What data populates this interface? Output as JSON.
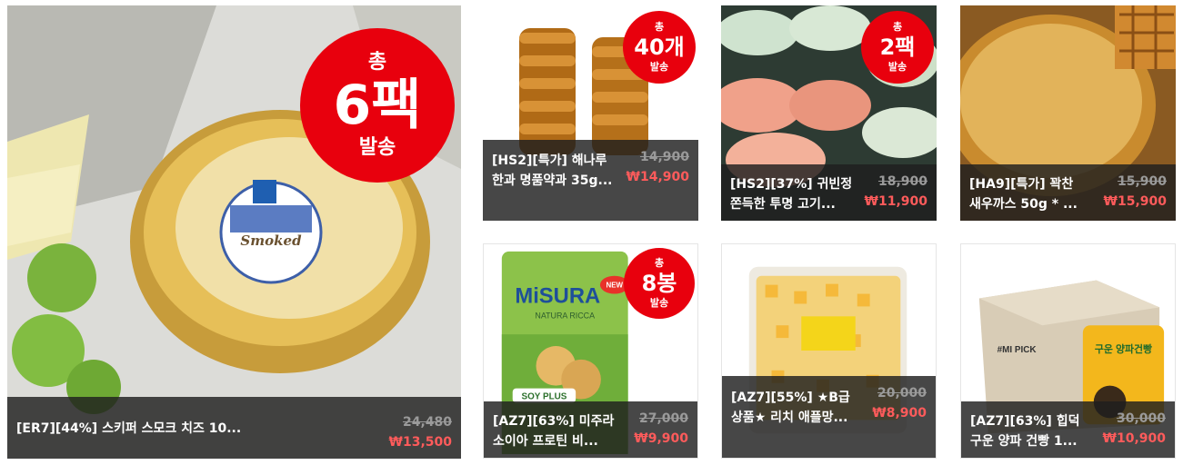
{
  "products": [
    {
      "name": "[ER7][44%] 스키퍼 스모크 치즈 10...",
      "old_price": "24,480",
      "new_price": "₩13,500",
      "badge": {
        "top": "총",
        "big": "6팩",
        "bottom": "발송"
      }
    },
    {
      "name": "[HS2][특가] 해나루 한과 명품약과 35g...",
      "old_price": "14,900",
      "new_price": "₩14,900",
      "badge": {
        "top": "총",
        "big": "40개",
        "bottom": "발송"
      }
    },
    {
      "name": "[HS2][37%] 귀빈정 쫀득한 투명 고기...",
      "old_price": "18,900",
      "new_price": "₩11,900",
      "badge": {
        "top": "총",
        "big": "2팩",
        "bottom": "발송"
      }
    },
    {
      "name": "[HA9][특가] 꽉찬 새우까스 50g * ...",
      "old_price": "15,900",
      "new_price": "₩15,900"
    },
    {
      "name": "[AZ7][63%] 미주라 소이아 프로틴 비...",
      "old_price": "27,000",
      "new_price": "₩9,900",
      "badge": {
        "top": "총",
        "big": "8봉",
        "bottom": "발송"
      },
      "package": {
        "brand": "MiSURA",
        "line": "NATURA RICCA",
        "soy": "SOY PLUS",
        "new": "NEW"
      }
    },
    {
      "name": "[AZ7][55%] ★B급 상품★ 리치 애플망...",
      "old_price": "20,000",
      "new_price": "₩8,900"
    },
    {
      "name": "[AZ7][63%] 힙덕 구운 양파 건빵 1...",
      "old_price": "30,000",
      "new_price": "₩10,900",
      "package": {
        "box_text": "#MI PICK",
        "bag_text": "구운 양파건빵"
      }
    }
  ],
  "cheese_label": "Smoked"
}
